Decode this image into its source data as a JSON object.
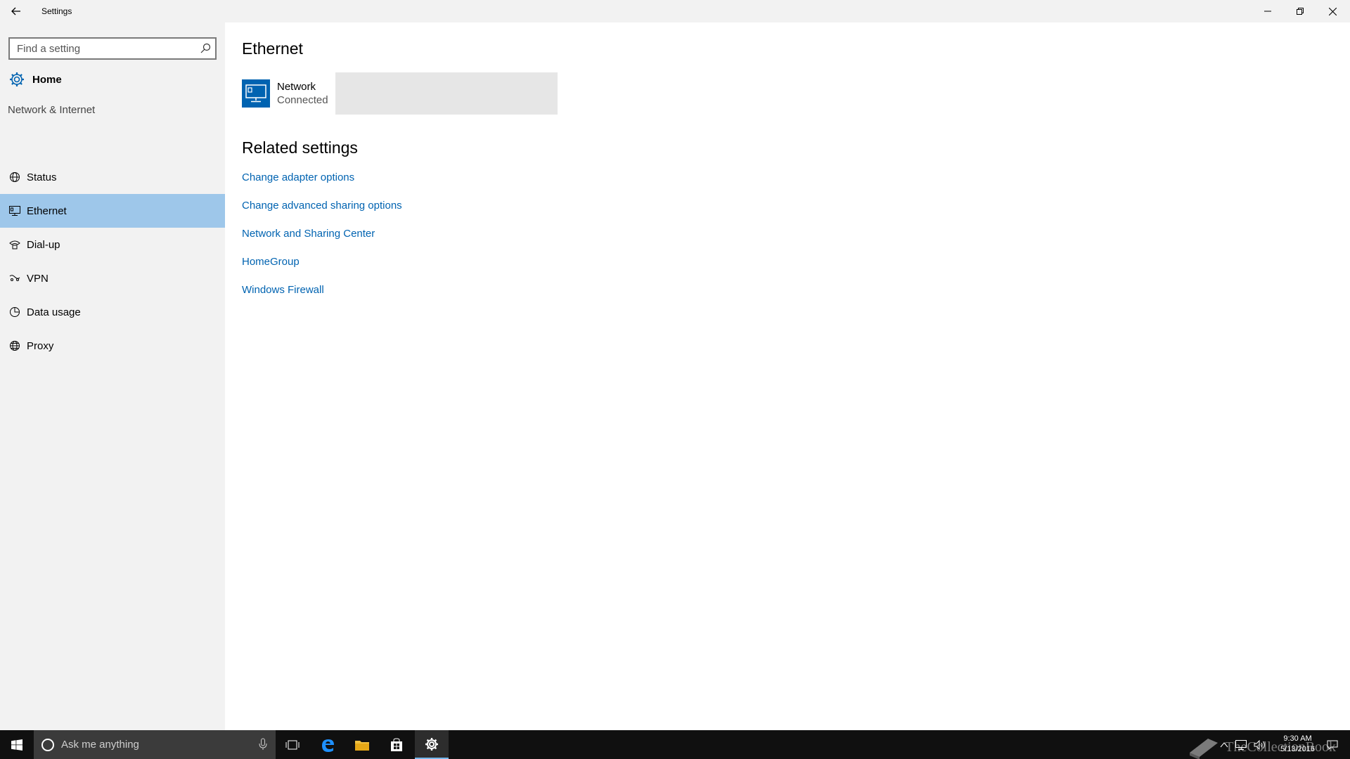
{
  "window": {
    "title": "Settings",
    "minimize_icon": "minimize-icon",
    "restore_icon": "restore-icon",
    "close_icon": "close-icon"
  },
  "sidebar": {
    "search_placeholder": "Find a setting",
    "home_label": "Home",
    "section_title": "Network & Internet",
    "items": [
      {
        "label": "Status",
        "icon": "status-globe-icon",
        "active": false
      },
      {
        "label": "Ethernet",
        "icon": "ethernet-icon",
        "active": true
      },
      {
        "label": "Dial-up",
        "icon": "dialup-icon",
        "active": false
      },
      {
        "label": "VPN",
        "icon": "vpn-icon",
        "active": false
      },
      {
        "label": "Data usage",
        "icon": "data-usage-icon",
        "active": false
      },
      {
        "label": "Proxy",
        "icon": "proxy-globe-icon",
        "active": false
      }
    ]
  },
  "main": {
    "title": "Ethernet",
    "network": {
      "name": "Network",
      "status": "Connected",
      "icon_color": "#0063b1"
    },
    "related_title": "Related settings",
    "links": [
      "Change adapter options",
      "Change advanced sharing options",
      "Network and Sharing Center",
      "HomeGroup",
      "Windows Firewall"
    ]
  },
  "taskbar": {
    "search_placeholder": "Ask me anything",
    "time": "9:30 AM",
    "date": "5/13/2016",
    "watermark": "TheCollectionBook",
    "accent": "#76b9ed"
  },
  "colors": {
    "sidebar_bg": "#f2f2f2",
    "active_item_bg": "#9ec7ea",
    "link": "#0063b1",
    "taskbar_bg": "#101010"
  }
}
